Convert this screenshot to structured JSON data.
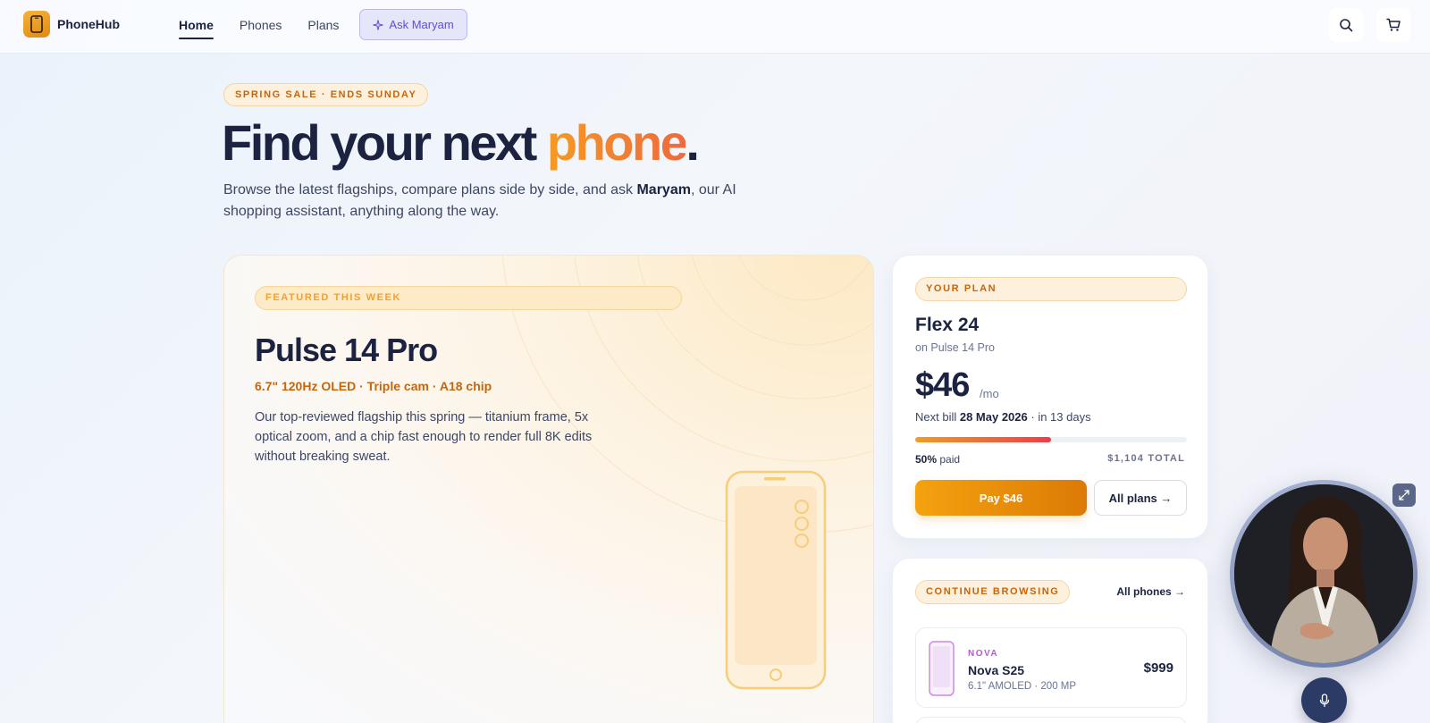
{
  "header": {
    "brand": "PhoneHub",
    "nav": [
      {
        "label": "Home",
        "active": true
      },
      {
        "label": "Phones",
        "active": false
      },
      {
        "label": "Plans",
        "active": false
      }
    ],
    "ask_label": "Ask Maryam",
    "icons": [
      "search-icon",
      "cart-icon"
    ]
  },
  "hero": {
    "badge": "SPRING SALE · ENDS SUNDAY",
    "title_main": "Find your next ",
    "title_accent": "phone",
    "title_end": ".",
    "subtitle_before": "Browse the latest flagships, compare plans side by side, and ask ",
    "subtitle_name": "Maryam",
    "subtitle_after": ", our AI shopping assistant, anything along the way."
  },
  "featured": {
    "badge": "FEATURED THIS WEEK",
    "name": "Pulse 14 Pro",
    "specs": "6.7\" 120Hz OLED · Triple cam · A18 chip",
    "description": "Our top-reviewed flagship this spring — titanium frame, 5x optical zoom, and a chip fast enough to render full 8K edits without breaking sweat."
  },
  "plan": {
    "badge": "YOUR PLAN",
    "name": "Flex 24",
    "on_phone": "on Pulse 14 Pro",
    "price": "$46",
    "per": "/mo",
    "next_bill_prefix": "Next bill ",
    "next_bill_date": "28 May 2026",
    "next_bill_suffix": " · in 13 days",
    "paid_fraction": 0.5,
    "paid_percent": "50%",
    "paid_word": " paid",
    "total": "$1,104 TOTAL",
    "pay_label": "Pay $46",
    "all_plans_label": "All plans →"
  },
  "browse": {
    "badge": "CONTINUE BROWSING",
    "all_phones": "All phones →",
    "items": [
      {
        "brand": "NOVA",
        "name": "Nova S25",
        "specs": "6.1\" AMOLED · 200 MP",
        "price": "$999"
      }
    ]
  },
  "assistant": {
    "icons": [
      "expand-icon",
      "microphone-icon"
    ]
  },
  "colors": {
    "brand_orange": "#f4a20f",
    "navy": "#1b2340",
    "accent_purple": "#5b4fd6",
    "nova_purple": "#b85ad8"
  }
}
